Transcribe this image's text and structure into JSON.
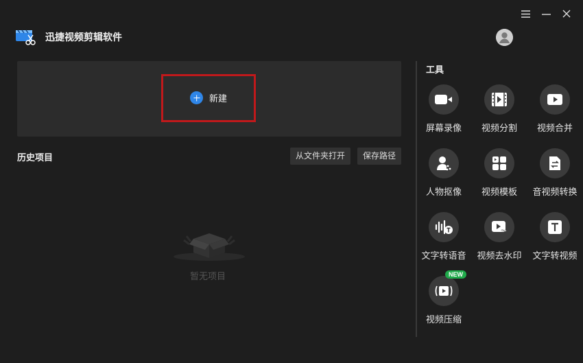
{
  "window": {
    "controls": {
      "menu_icon": "menu-icon",
      "minimize_icon": "minimize-icon",
      "close_icon": "close-icon"
    }
  },
  "app": {
    "title": "迅捷视频剪辑软件",
    "logo_icon": "film-scissors-icon"
  },
  "user": {
    "avatar_icon": "user-avatar-icon"
  },
  "create": {
    "label": "新建",
    "icon": "plus-circle-icon"
  },
  "history": {
    "title": "历史项目",
    "open_from_folder": "从文件夹打开",
    "save_path": "保存路径",
    "empty_text": "暂无项目"
  },
  "tools": {
    "title": "工具",
    "items": [
      {
        "label": "屏幕录像",
        "icon": "camera-icon"
      },
      {
        "label": "视频分割",
        "icon": "film-split-icon"
      },
      {
        "label": "视频合并",
        "icon": "video-merge-icon"
      },
      {
        "label": "人物抠像",
        "icon": "person-cutout-icon"
      },
      {
        "label": "视频模板",
        "icon": "template-icon"
      },
      {
        "label": "音视频转换",
        "icon": "convert-icon"
      },
      {
        "label": "文字转语音",
        "icon": "text-to-speech-icon"
      },
      {
        "label": "视频去水印",
        "icon": "watermark-remove-icon"
      },
      {
        "label": "文字转视频",
        "icon": "text-to-video-icon"
      },
      {
        "label": "视频压缩",
        "icon": "compress-icon",
        "badge": "NEW"
      }
    ]
  },
  "colors": {
    "background": "#1e1e1e",
    "panel": "#2c2c2c",
    "accent": "#2f86e8",
    "highlight": "#c0191b",
    "badge": "#1faa4a"
  }
}
